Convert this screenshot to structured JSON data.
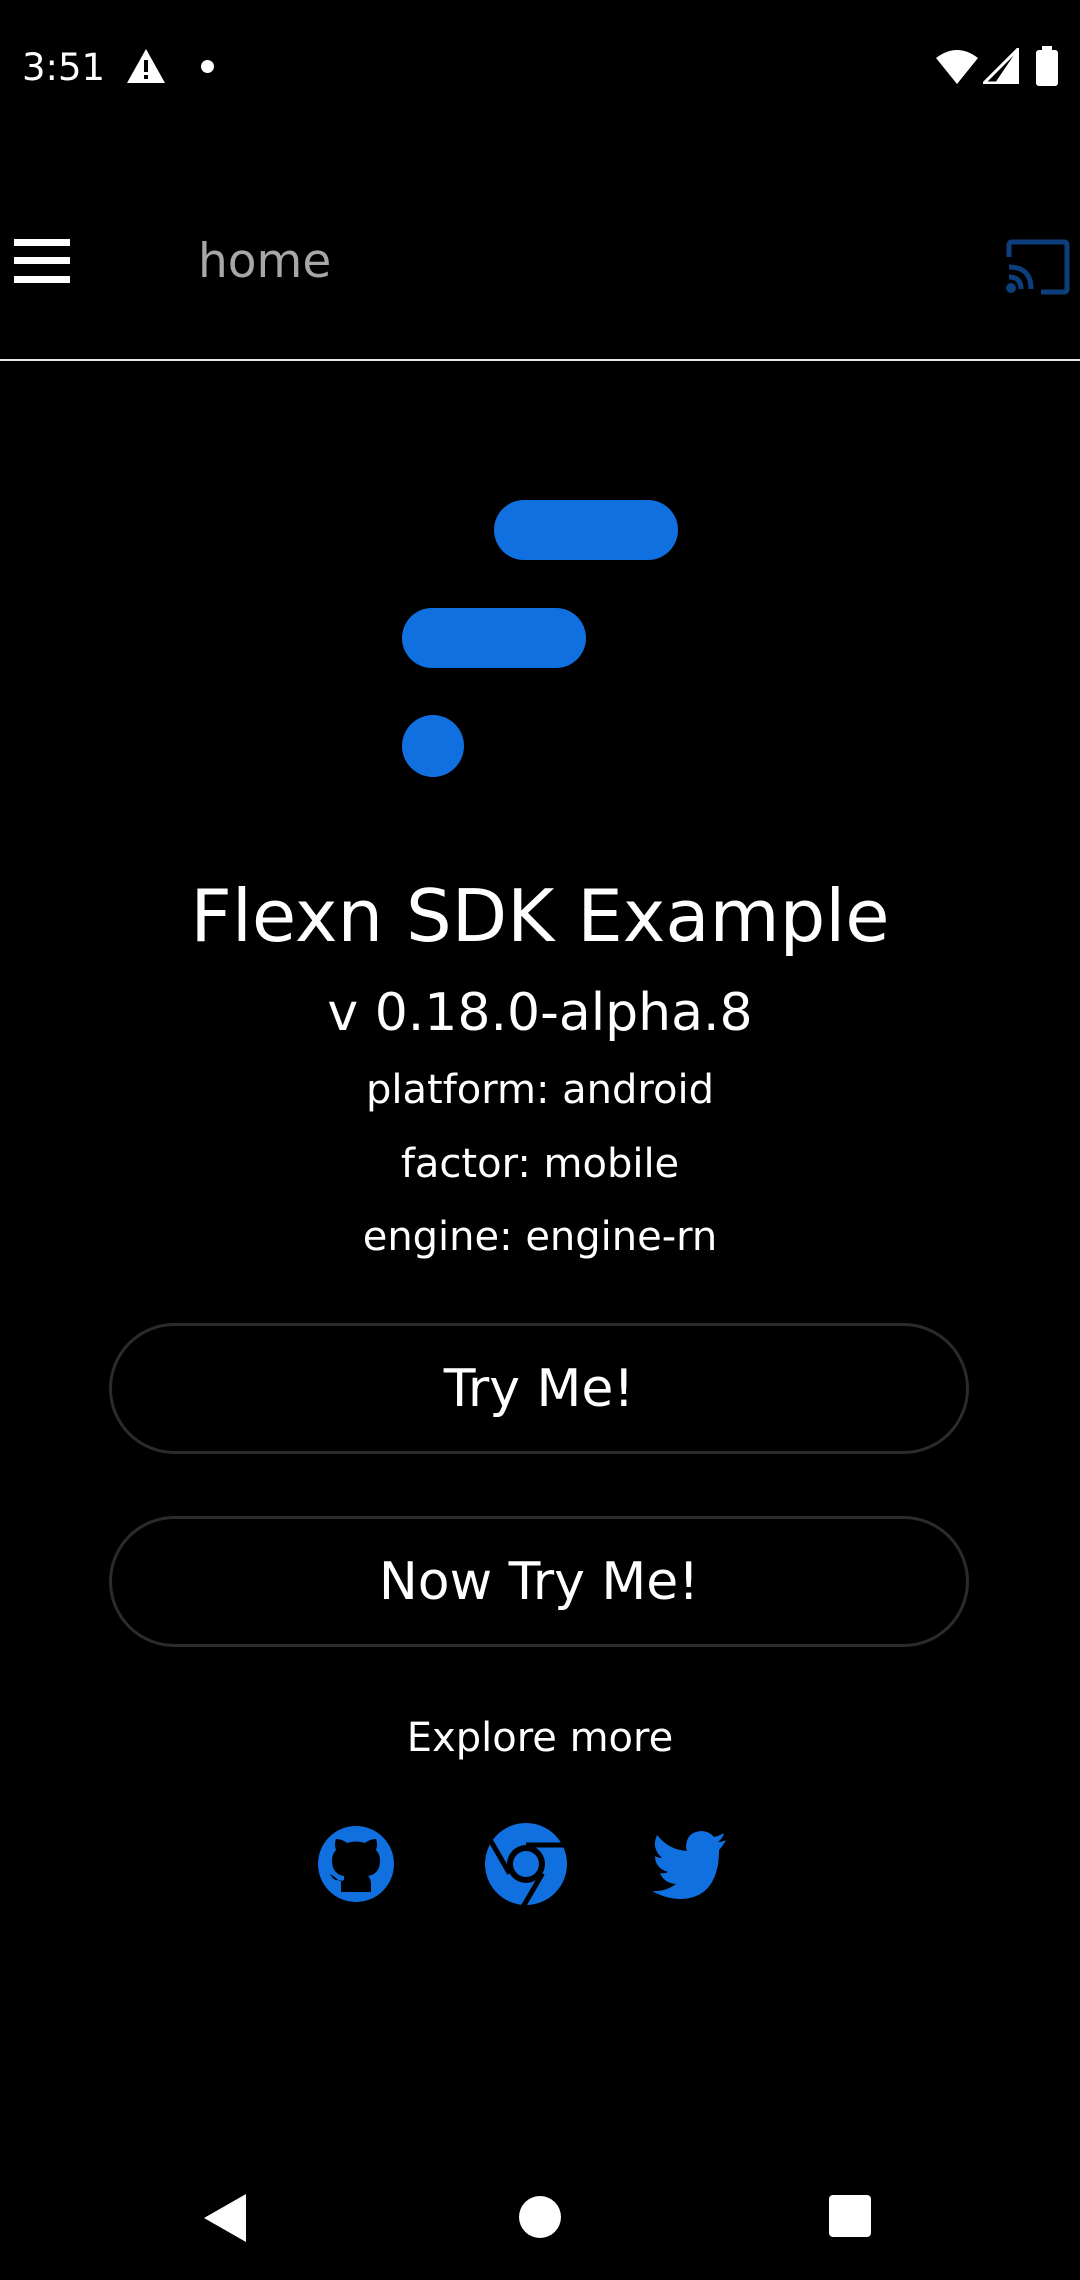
{
  "status_bar": {
    "time": "3:51",
    "icons": [
      "warning-icon",
      "notification-dot-icon",
      "wifi-icon",
      "cellular-signal-icon",
      "battery-icon"
    ]
  },
  "app_bar": {
    "title": "home",
    "menu_icon": "hamburger-menu-icon",
    "cast_icon": "cast-icon"
  },
  "main": {
    "logo_icon": "flexn-logo",
    "title": "Flexn SDK Example",
    "version": "v 0.18.0-alpha.8",
    "platform": "platform: android",
    "factor": "factor: mobile",
    "engine": "engine: engine-rn",
    "buttons": [
      {
        "label": "Try Me!"
      },
      {
        "label": "Now Try Me!"
      }
    ],
    "explore_label": "Explore more",
    "social_links": [
      {
        "icon": "github-icon"
      },
      {
        "icon": "chrome-icon"
      },
      {
        "icon": "twitter-icon"
      }
    ]
  },
  "nav_bar": {
    "icons": [
      "back-icon",
      "home-icon",
      "recents-icon"
    ]
  },
  "colors": {
    "background": "#000000",
    "accent": "#1070e0",
    "title_text": "#a7a7a7",
    "button_border": "#2b2b2b"
  }
}
